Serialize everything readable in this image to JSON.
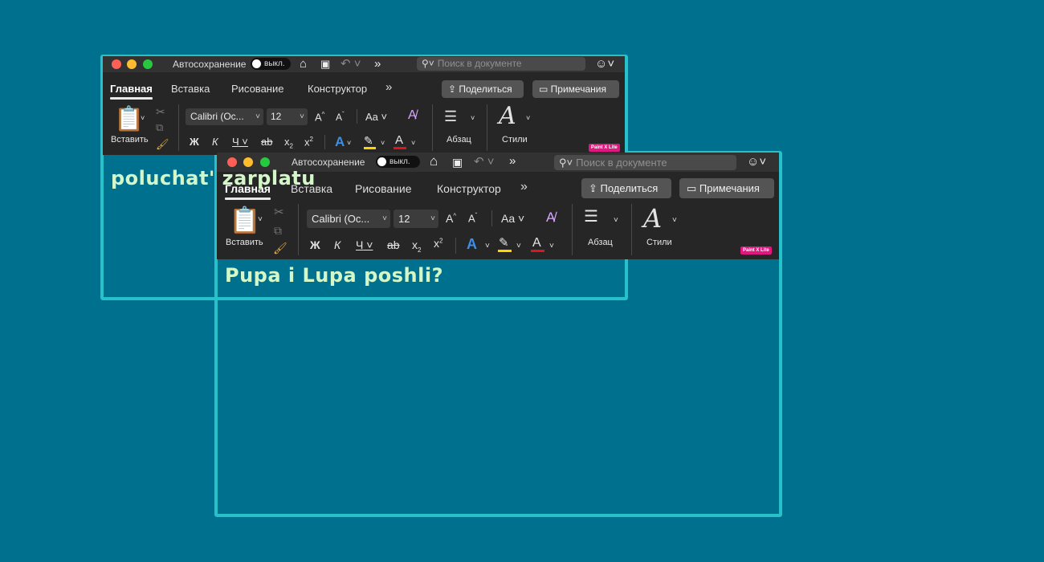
{
  "colors": {
    "background": "#00708f",
    "frame": "#26c1c9",
    "caption": "#d3f7c8",
    "badge": "#e0177f",
    "highlight_bar": "#ffd400",
    "font_color_bar": "#e0141b"
  },
  "captions": {
    "back": "poluchat' zarplatu",
    "front": "Pupa i Lupa poshli?"
  },
  "word_window": {
    "autosave_label": "Автосохранение",
    "autosave_state": "выкл.",
    "search_placeholder": "Поиск в документе",
    "tabs": [
      "Главная",
      "Вставка",
      "Рисование",
      "Конструктор"
    ],
    "active_tab": "Главная",
    "overflow_chevron": "»",
    "share_button": "Поделиться",
    "comments_button": "Примечания",
    "paste_label": "Вставить",
    "font_name": "Calibri (Ос...",
    "font_size": "12",
    "grow_font": "A",
    "shrink_font": "A",
    "change_case": "Aa",
    "bold": "Ж",
    "italic": "К",
    "underline": "Ч",
    "strike": "ab",
    "subscript": "x",
    "superscript": "x",
    "subscript_mark": "2",
    "superscript_mark": "2",
    "text_effects": "A",
    "font_color": "A",
    "paragraph_label": "Абзац",
    "styles_label": "Стили",
    "badge_text": "Paint X Lite",
    "icons": [
      "home-icon",
      "save-icon",
      "undo-icon",
      "overflow-icon",
      "search-icon",
      "smiley-icon",
      "paste-icon",
      "cut-icon",
      "copy-icon",
      "format-painter-icon",
      "clear-format-icon",
      "paragraph-icon",
      "styles-icon",
      "share-icon",
      "comment-icon"
    ]
  }
}
